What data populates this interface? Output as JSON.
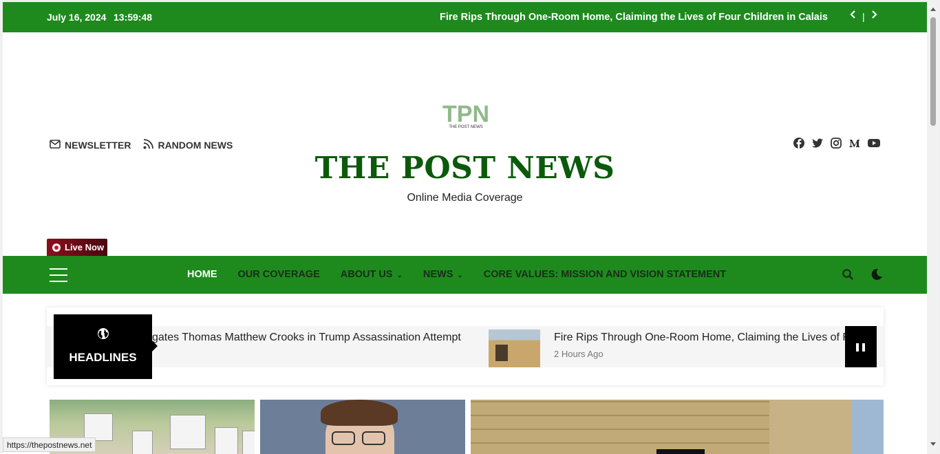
{
  "topbar": {
    "date": "July 16, 2024",
    "time": "13:59:48",
    "ticker_text": "Fire Rips Through One-Room Home, Claiming the Lives of Four Children in Calais",
    "prev_icon": "chevron-left-icon",
    "next_icon": "chevron-right-icon",
    "separator": "|"
  },
  "header": {
    "logo_text": "TPN",
    "logo_subtext": "THE POST NEWS",
    "site_title": "THE POST NEWS",
    "tagline": "Online Media Coverage",
    "links": [
      {
        "label": "NEWSLETTER",
        "icon": "envelope-icon"
      },
      {
        "label": "RANDOM NEWS",
        "icon": "rss-icon"
      }
    ],
    "social": [
      "facebook-icon",
      "twitter-icon",
      "instagram-icon",
      "medium-icon",
      "youtube-icon"
    ]
  },
  "live": {
    "label": "Live Now"
  },
  "nav": {
    "items": [
      {
        "label": "HOME",
        "active": true
      },
      {
        "label": "OUR COVERAGE"
      },
      {
        "label": "ABOUT US",
        "dropdown": true
      },
      {
        "label": "NEWS",
        "dropdown": true
      },
      {
        "label": "CORE VALUES: MISSION AND VISION STATEMENT"
      }
    ],
    "caret": "⌄"
  },
  "headlines": {
    "label": "HEADLINES",
    "item1_text": "gates Thomas Matthew Crooks in Trump Assassination Attempt",
    "item2_text": "Fire Rips Through One-Room Home, Claiming the Lives of F",
    "item2_time": "2 Hours Ago"
  },
  "status_bar": {
    "url": "https://thepostnews.net"
  },
  "colors": {
    "brand_green": "#1e8a1e",
    "title_green": "#0b5a0b",
    "live_red": "#8b0e1e"
  }
}
